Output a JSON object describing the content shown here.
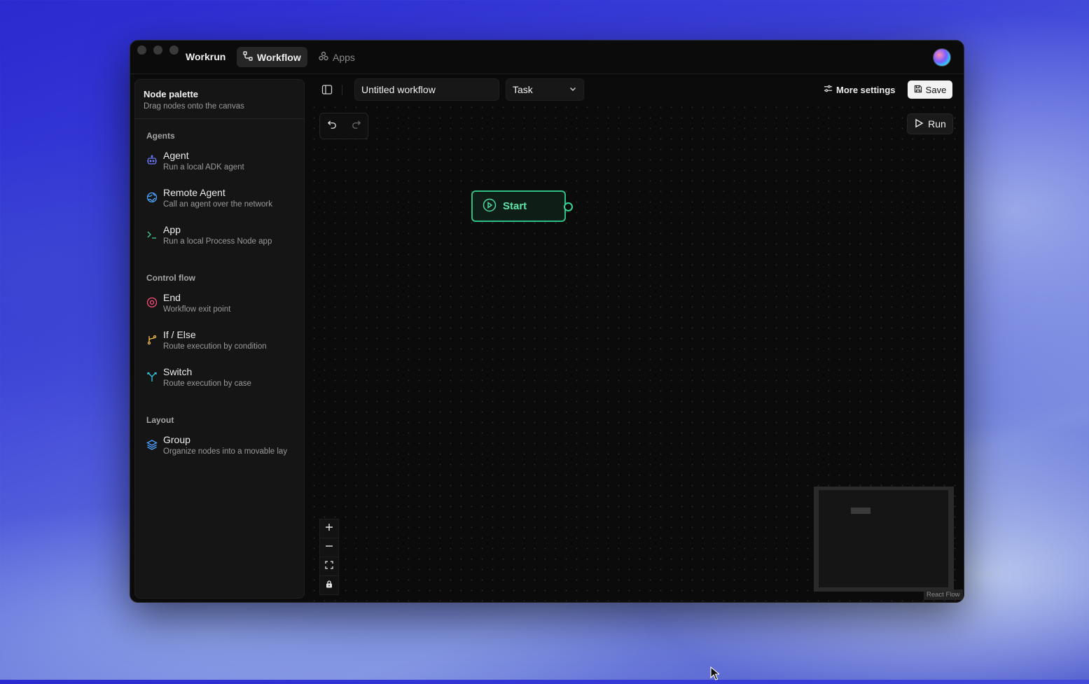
{
  "app": {
    "brand": "Workrun",
    "tabs": [
      {
        "label": "Workflow",
        "icon": "workflow-icon",
        "active": true
      },
      {
        "label": "Apps",
        "icon": "apps-icon",
        "active": false
      }
    ]
  },
  "sidebar": {
    "title": "Node palette",
    "subtitle": "Drag nodes onto the canvas",
    "sections": [
      {
        "label": "Agents",
        "items": [
          {
            "label": "Agent",
            "desc": "Run a local ADK agent",
            "icon": "robot-icon",
            "color": "#6b7bff"
          },
          {
            "label": "Remote Agent",
            "desc": "Call an agent over the network",
            "icon": "globe-icon",
            "color": "#4aa3ff"
          },
          {
            "label": "App",
            "desc": "Run a local Process Node app",
            "icon": "terminal-icon",
            "color": "#3fcf8e"
          }
        ]
      },
      {
        "label": "Control flow",
        "items": [
          {
            "label": "End",
            "desc": "Workflow exit point",
            "icon": "stop-circle-icon",
            "color": "#ff4d7a"
          },
          {
            "label": "If / Else",
            "desc": "Route execution by condition",
            "icon": "branch-icon",
            "color": "#f2b84b"
          },
          {
            "label": "Switch",
            "desc": "Route execution by case",
            "icon": "split-icon",
            "color": "#36c9e6"
          }
        ]
      },
      {
        "label": "Layout",
        "items": [
          {
            "label": "Group",
            "desc": "Organize nodes into a movable lay",
            "icon": "layers-icon",
            "color": "#4aa3ff"
          }
        ]
      }
    ]
  },
  "toolbar": {
    "workflow_name": "Untitled workflow",
    "workflow_type": "Task",
    "more_settings": "More settings",
    "save": "Save",
    "run": "Run"
  },
  "canvas": {
    "start_node_label": "Start",
    "attribution": "React Flow"
  },
  "colors": {
    "accent_green": "#2fbf84",
    "window_bg": "#0b0b0b"
  }
}
